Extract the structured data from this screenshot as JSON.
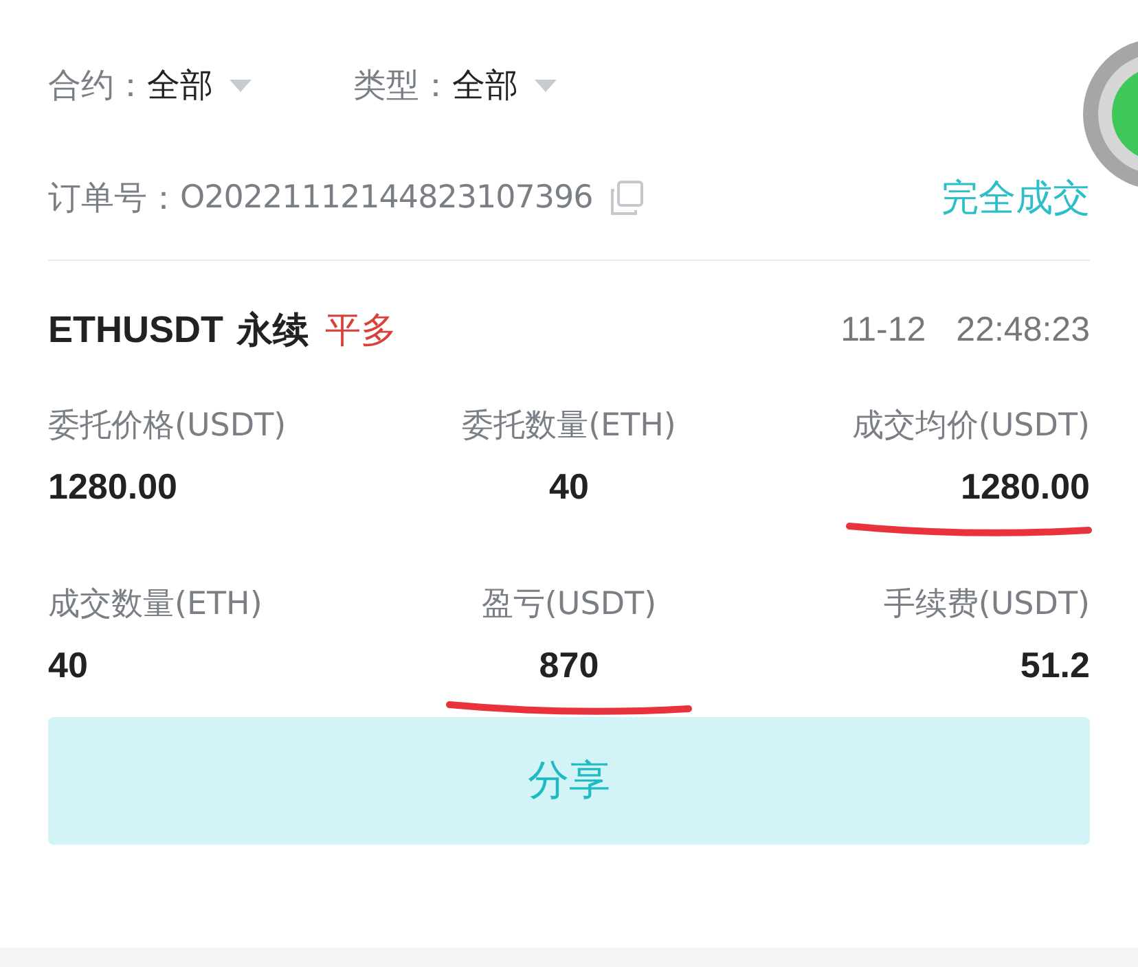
{
  "filters": [
    {
      "label": "合约：",
      "value": "全部"
    },
    {
      "label": "类型：",
      "value": "全部"
    }
  ],
  "order": {
    "label": "订单号：",
    "number": "O20221112144823107396",
    "status": "完全成交"
  },
  "trade": {
    "symbol": "ETHUSDT",
    "contract": "永续",
    "side": "平多",
    "date": "11-12",
    "time": "22:48:23"
  },
  "fields": [
    {
      "label": "委托价格(USDT)",
      "value": "1280.00",
      "underlined": false
    },
    {
      "label": "委托数量(ETH)",
      "value": "40",
      "underlined": false
    },
    {
      "label": "成交均价(USDT)",
      "value": "1280.00",
      "underlined": true
    },
    {
      "label": "成交数量(ETH)",
      "value": "40",
      "underlined": false
    },
    {
      "label": "盈亏(USDT)",
      "value": "870",
      "underlined": true
    },
    {
      "label": "手续费(USDT)",
      "value": "51.2",
      "underlined": false
    }
  ],
  "share_button": "分享"
}
